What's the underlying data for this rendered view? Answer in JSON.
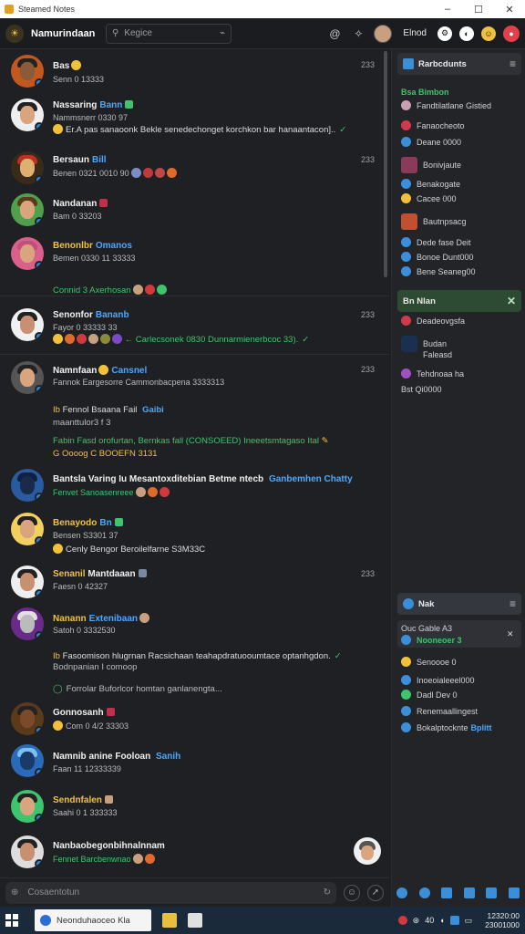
{
  "window": {
    "title": "Steamed Notes"
  },
  "header": {
    "server_name": "Namurindaan",
    "search_placeholder": "Kegice",
    "user_label": "Elnod"
  },
  "messages": [
    {
      "name": "Bas",
      "sub": "Senn 0 13333",
      "time": "233"
    },
    {
      "name": "Nassaring",
      "tag": "Bann",
      "sub": "Nammsnerr 0330 97",
      "text": "Er.A pas sanaoonk Bekle senedechonget korchkon bar hanaantacon].."
    },
    {
      "name": "Bersaun",
      "tag": "Bill",
      "sub": "Benen 0321 0010 90",
      "time": "233"
    },
    {
      "name": "Nandanan",
      "sub": "Bam 0 33203"
    },
    {
      "name": "Benonlbr",
      "tag": "Omanos",
      "sub": "Bemen 0330 11 33333",
      "text": "Connid 3 Axerhosan"
    },
    {
      "name": "Senonfor",
      "tag": "Bananb",
      "sub": "Fayor 0 33333 33",
      "time": "233",
      "text": "Carlecsonek 0830 Dunnarmienerbcoc 33)."
    },
    {
      "name": "Namnfaan",
      "tag": "Cansnel",
      "sub": "Fannok Eargesorre Cammonbacpena 3333313",
      "time": "233",
      "text": "Fennol Bsaana Fail",
      "link": "Gaibi",
      "text2": "maanttulor3 f 3",
      "text3": "Fabin Fasd orofurtan, Bernkas fall (CONSOEED) Ineeetsmtagaso Ital",
      "text4": "G Oooog C BOOEFN 3131"
    },
    {
      "name": "Bantsla Varing Iu Mesantoxditebian Betme ntecb",
      "tag": "Ganbemhen Chatty",
      "sub": "Fenvet Sanoasenreee"
    },
    {
      "name": "Benayodo",
      "tag": "Bn",
      "sub": "Bensen S3301 37",
      "text": "Cenly Bengor Beroilelfarne S3M33C"
    },
    {
      "name": "Senanil",
      "tag": "Mantdaaan",
      "sub": "Faesn 0 42327",
      "time": "233"
    },
    {
      "name": "Nanann",
      "tag": "Extenibaan",
      "sub": "Satoh 0 3332530",
      "text": "Fasoomison hlugrnan Racsichaan teahapdratuooumtace optanhgdon.",
      "text2": "Bodnpanian I comoop",
      "text3": "Forrolar Buforlcor homtan ganlanengta..."
    },
    {
      "name": "Gonnosanh",
      "sub": "Com 0 4/2 33303"
    },
    {
      "name": "Namnib anine Fooloan",
      "tag": "Sanih",
      "sub": "Faan 11 12333339"
    },
    {
      "name": "Sendnfalen",
      "sub": "Saahi 0 1 333333"
    },
    {
      "name": "Nanbaobegonbihnalnnam",
      "sub": "Fennet Barcbenwnao"
    }
  ],
  "composer": {
    "placeholder": "Cosaentotun"
  },
  "right_panel": {
    "card1": {
      "title": "Rarbcdunts",
      "section": "Bsa Bimbon",
      "rows": [
        "Fandtilatlane Gistied",
        "Fanaocheoto",
        "Deane 0000",
        "Bonivjaute",
        "Benakogate",
        "Cacee 000",
        "Bautnpsacg",
        "Dede fase Deit",
        "Bonoe Dunt000",
        "Bene Seaneg00"
      ]
    },
    "card2": {
      "title": "Bn Nlan",
      "rows": [
        "Deadeovgsfa",
        "Budan",
        "Faleasd",
        "Tehdnoaa ha",
        "Bst Qi0000"
      ]
    },
    "card3": {
      "title": "Nak",
      "highlight": "Ouc Gable A3",
      "highlight_sub": "Nooneoer 3",
      "rows": [
        "Senoooe 0",
        "Inoeoialeeel000",
        "Dadl Dev 0",
        "Renemaallingest",
        "Bokalptocknte"
      ],
      "rows_tag": "Bplitt"
    }
  },
  "taskbar": {
    "search_text": "Neonduhaoceo Kla",
    "clock_time": "12320:00",
    "clock_date": "23001000",
    "tray_label": "40"
  }
}
